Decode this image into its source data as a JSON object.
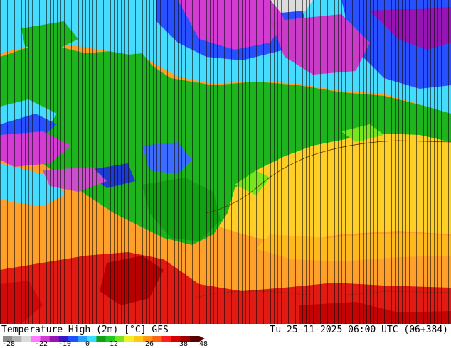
{
  "map": {
    "title": "Temperature High (2m) [°C] GFS",
    "timestamp": "Tu 25-11-2025 06:00 UTC (06+384)",
    "legend": {
      "ticks": [
        "-28",
        "-22",
        "-10",
        "0",
        "12",
        "26",
        "38",
        "48"
      ],
      "colors": [
        "#8c8c8c",
        "#b4b4b4",
        "#dcdcdc",
        "#ff78ff",
        "#d23cd2",
        "#9614b4",
        "#3c14c8",
        "#1e50ff",
        "#28a0ff",
        "#3cdcff",
        "#14a014",
        "#1ec81e",
        "#78e61e",
        "#f0f028",
        "#ffc814",
        "#ff9614",
        "#ff6414",
        "#ff1e1e",
        "#d20000",
        "#9c0000",
        "#5a0000"
      ]
    },
    "palette": {
      "ocean": "#ff9a1e",
      "land_warm": "#ffcf28",
      "cold_green": "#1eb41e",
      "cold_cyan": "#46dcff",
      "cold_blue": "#2850ff",
      "cold_magenta": "#d23cd2",
      "hot_red": "#e01414"
    }
  }
}
